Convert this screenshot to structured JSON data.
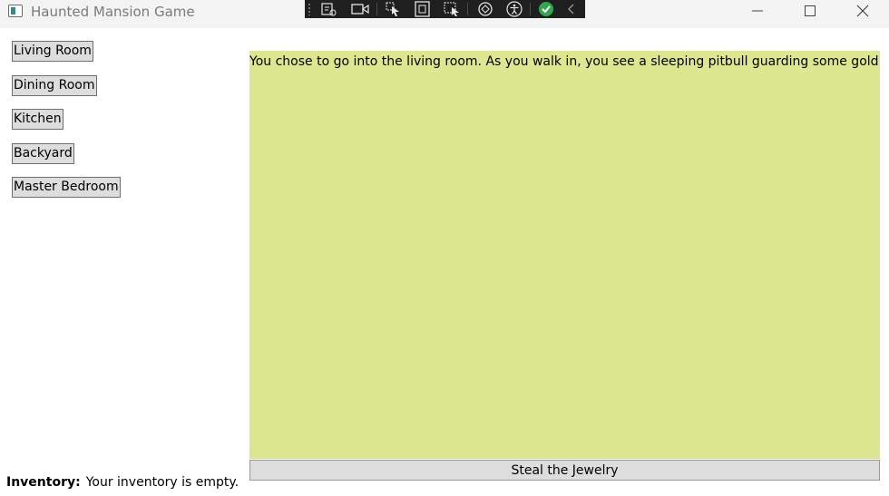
{
  "window": {
    "title": "Haunted Mansion Game"
  },
  "debug_toolbar": {
    "icons": [
      "select-element-icon",
      "record-icon",
      "pointer-select-icon",
      "display-layout-icon",
      "track-focus-icon",
      "hot-reload-icon",
      "accessibility-icon",
      "check-icon",
      "collapse-chevron-icon"
    ]
  },
  "rooms": [
    {
      "label": "Living Room"
    },
    {
      "label": "Dining Room"
    },
    {
      "label": "Kitchen"
    },
    {
      "label": "Backyard"
    },
    {
      "label": "Master Bedroom"
    }
  ],
  "story": {
    "text": "You chose to go into the living room. As you walk in, you see a sleeping pitbull guarding some gold jewelry."
  },
  "action": {
    "label": "Steal the Jewelry"
  },
  "inventory": {
    "label": "Inventory:",
    "value": "Your inventory is empty."
  },
  "colors": {
    "story_background": "#dde78f",
    "button_background": "#dddddd",
    "titlebar_background": "#f3f3f3",
    "debug_toolbar_background": "#1f1f1f"
  }
}
